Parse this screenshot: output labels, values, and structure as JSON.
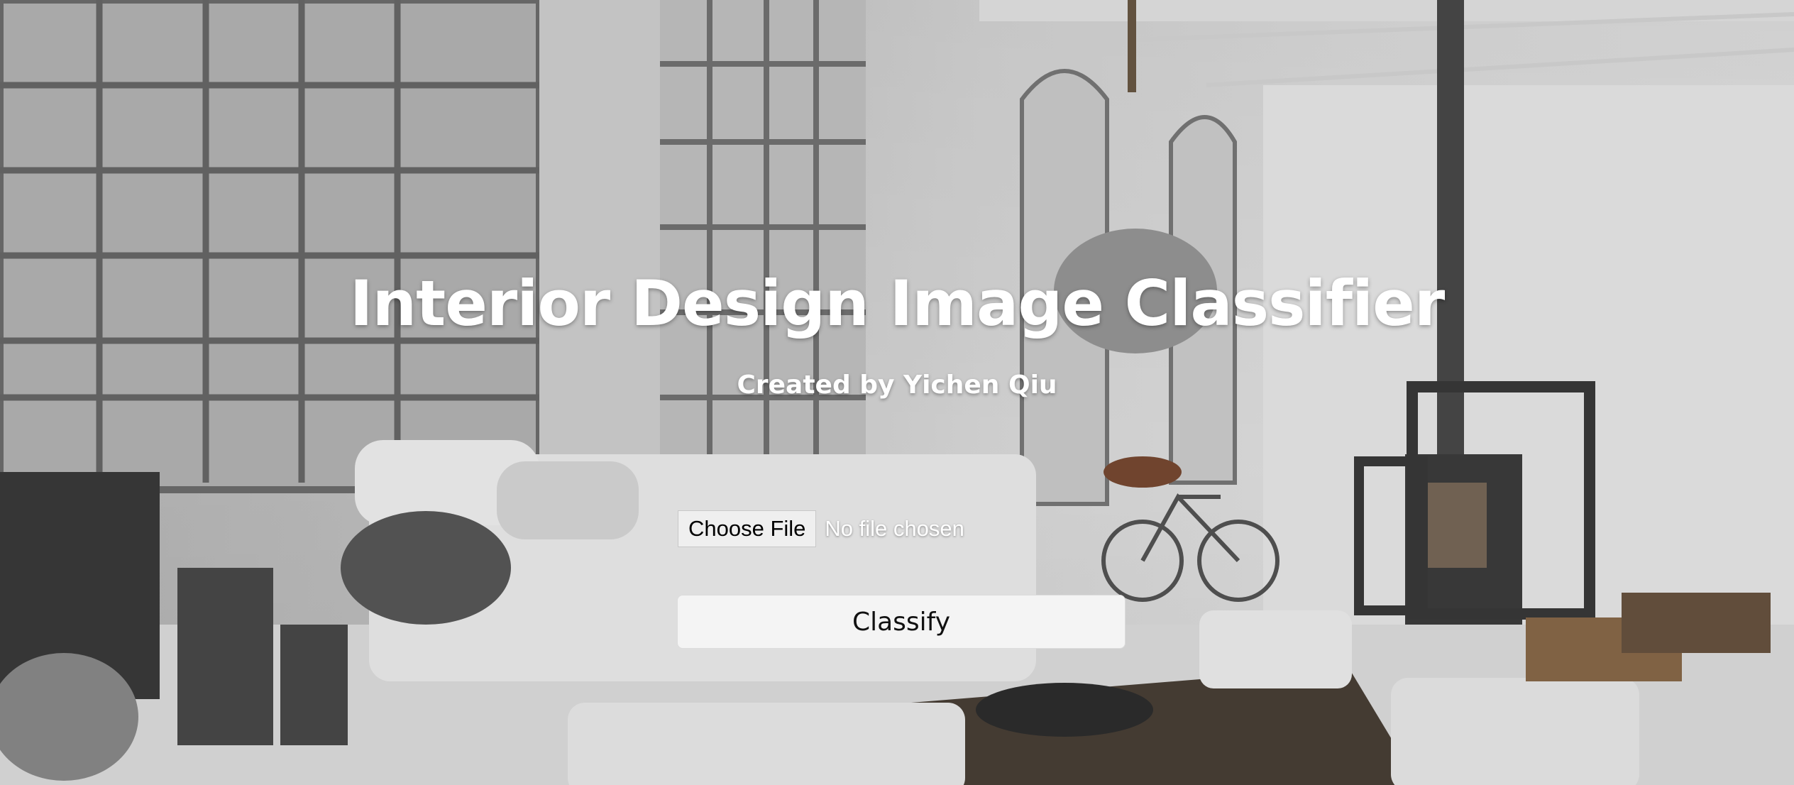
{
  "header": {
    "title": "Interior Design Image Classifier",
    "subtitle": "Created by Yichen Qiu"
  },
  "upload": {
    "choose_label": "Choose File",
    "status": "No file chosen"
  },
  "actions": {
    "classify_label": "Classify"
  },
  "background": {
    "description_icon": "loft-interior-photo"
  }
}
